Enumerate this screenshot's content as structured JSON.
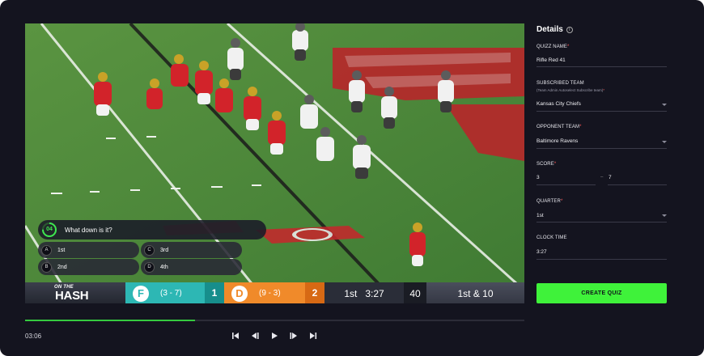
{
  "video": {
    "quiz": {
      "timer": "04",
      "timer_fraction": 0.75,
      "question": "What down is it?",
      "options": [
        {
          "letter": "A",
          "text": "1st"
        },
        {
          "letter": "C",
          "text": "3rd"
        },
        {
          "letter": "B",
          "text": "2nd"
        },
        {
          "letter": "D",
          "text": "4th"
        }
      ]
    },
    "scorebug": {
      "logo_line1": "ON THE",
      "logo_line2": "HASH",
      "team1_badge": "F",
      "team1_record": "(3 - 7)",
      "team1_score": "1",
      "team2_badge": "D",
      "team2_record": "(9 - 3)",
      "team2_score": "2",
      "clock": "1st   3:27",
      "play_clock": "40",
      "down_distance": "1st & 10"
    },
    "progress_fraction": 0.34,
    "current_time": "03:06"
  },
  "colors": {
    "accent_green": "#3ff23a",
    "team1": "#2db7b4",
    "team2": "#f08a2a"
  },
  "icons": [
    "skip-back-icon",
    "step-back-icon",
    "play-icon",
    "step-forward-icon",
    "skip-forward-icon",
    "info-icon",
    "chevron-down-icon"
  ],
  "panel": {
    "title": "Details",
    "quiz_name": {
      "label": "QUIZZ NAME",
      "value": "Rifle Red 41"
    },
    "subscribed_team": {
      "label": "SUBSCRIBED TEAM",
      "hint": "(Team Admin Autoselect Subscribe team)",
      "value": "Kansas City Chiefs"
    },
    "opponent_team": {
      "label": "OPPONENT TEAM",
      "value": "Baltimore Ravens"
    },
    "score": {
      "label": "SCORE",
      "home": "3",
      "sep": "–",
      "away": "7"
    },
    "quarter": {
      "label": "QUARTER",
      "value": "1st"
    },
    "clock_time": {
      "label": "CLOCK TIME",
      "value": "3:27"
    },
    "create_button": "CREATE QUIZ"
  }
}
